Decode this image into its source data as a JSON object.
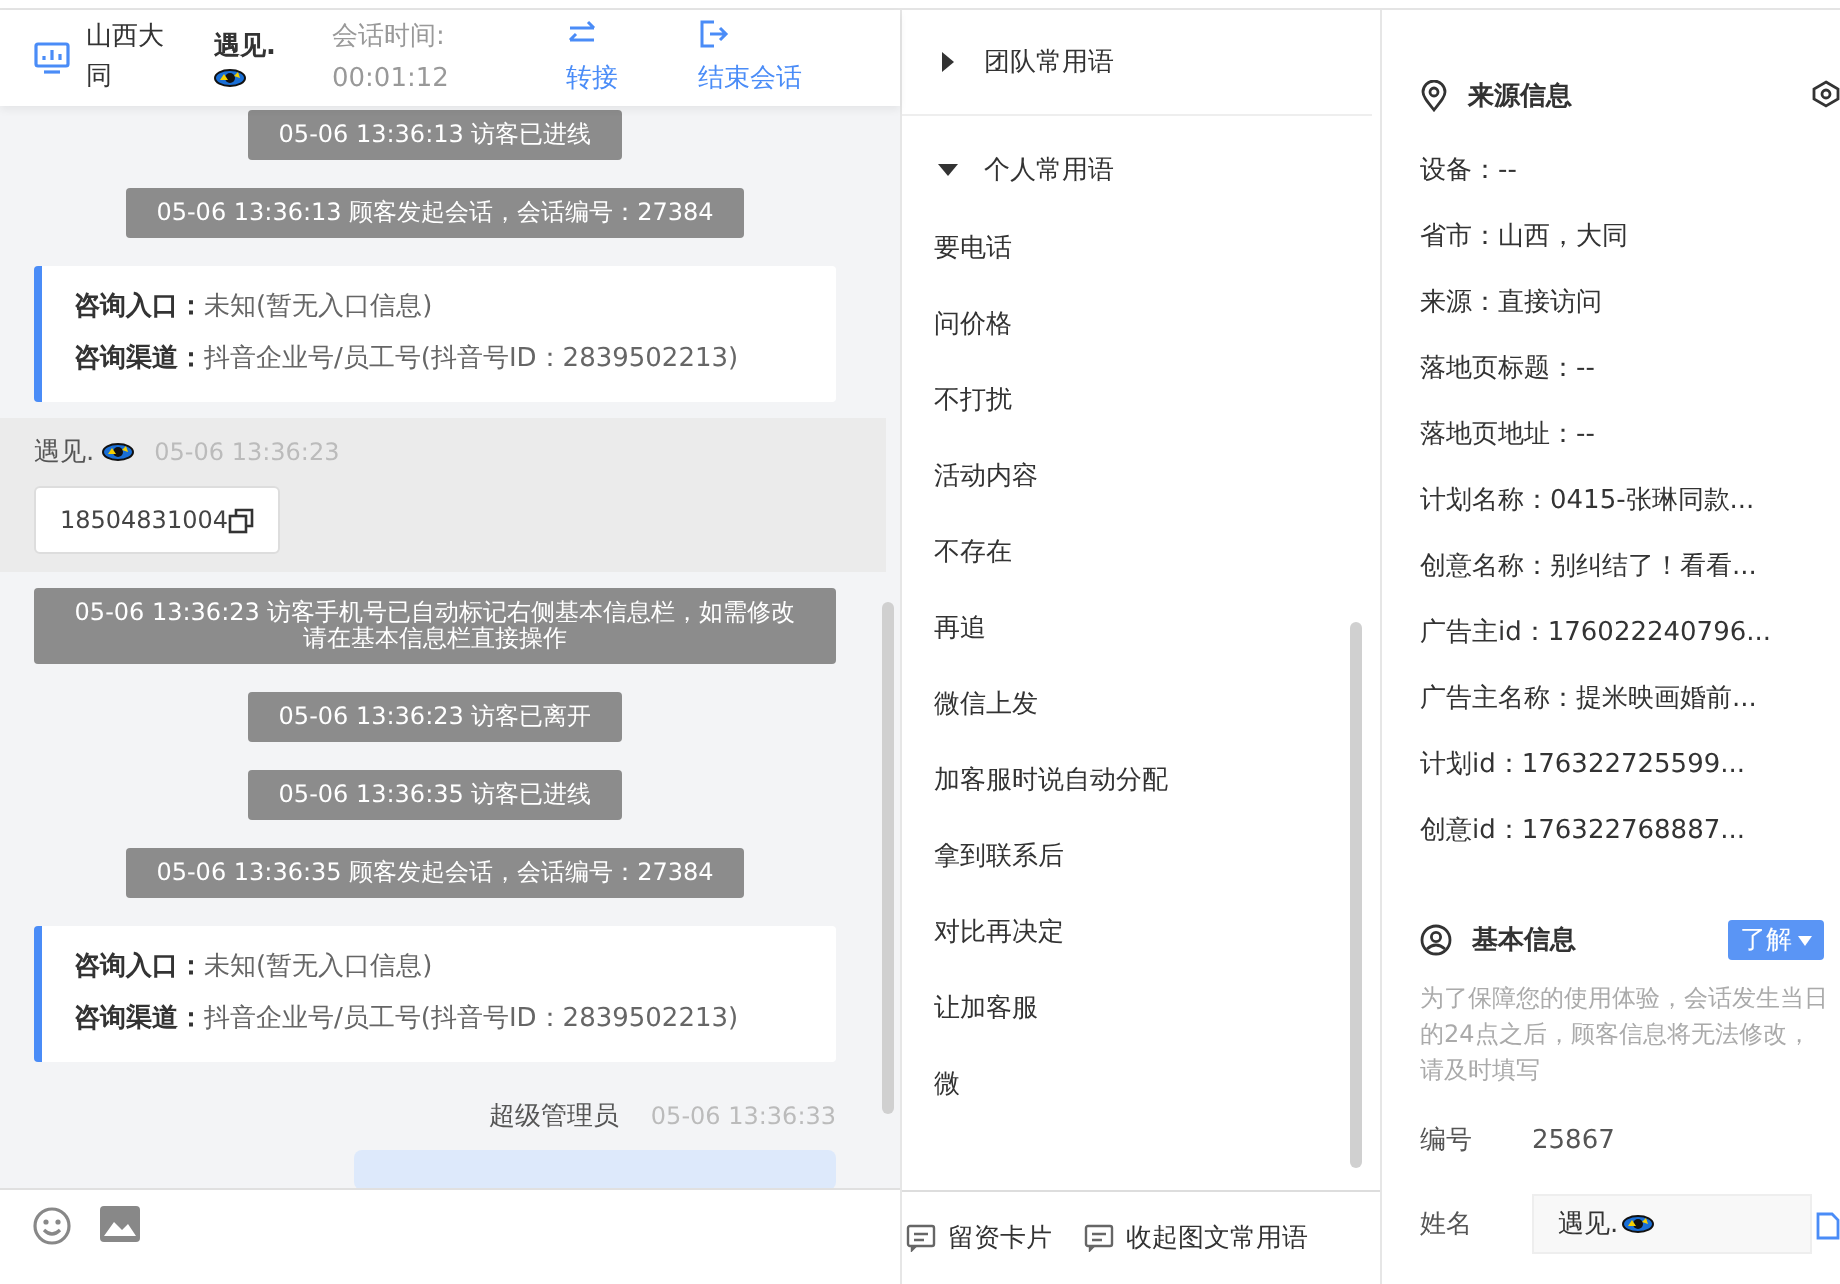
{
  "header": {
    "location": "山西大同",
    "visitor_name": "遇见.",
    "session_label": "会话时间:",
    "session_time": "00:01:12",
    "actions": [
      {
        "label": "转接",
        "kind": "transfer"
      },
      {
        "label": "结束会话",
        "kind": "end"
      }
    ]
  },
  "messages": [
    {
      "kind": "system",
      "text": "05-06 13:36:13 访客已进线"
    },
    {
      "kind": "system",
      "text": "05-06 13:36:13 顾客发起会话，会话编号：27384"
    },
    {
      "kind": "info_card",
      "rows": [
        {
          "label": "咨询入口：",
          "value": "未知(暂无入口信息)"
        },
        {
          "label": "咨询渠道：",
          "value": "抖音企业号/员工号(抖音号ID：2839502213)"
        }
      ]
    },
    {
      "kind": "visitor",
      "sender": "遇见.",
      "time": "05-06 13:36:23",
      "text": "18504831004"
    },
    {
      "kind": "system",
      "text": "05-06 13:36:23 访客手机号已自动标记右侧基本信息栏，如需修改请在基本信息栏直接操作"
    },
    {
      "kind": "system",
      "text": "05-06 13:36:23 访客已离开"
    },
    {
      "kind": "system",
      "text": "05-06 13:36:35 访客已进线"
    },
    {
      "kind": "system",
      "text": "05-06 13:36:35 顾客发起会话，会话编号：27384"
    },
    {
      "kind": "info_card",
      "rows": [
        {
          "label": "咨询入口：",
          "value": "未知(暂无入口信息)"
        },
        {
          "label": "咨询渠道：",
          "value": "抖音企业号/员工号(抖音号ID：2839502213)"
        }
      ]
    },
    {
      "kind": "admin",
      "sender": "超级管理员",
      "time": "05-06 13:36:33"
    }
  ],
  "phrase_groups": [
    {
      "title": "团队常用语",
      "expanded": false
    },
    {
      "title": "个人常用语",
      "expanded": true,
      "items": [
        "要电话",
        "问价格",
        "不打扰",
        "活动内容",
        "不存在",
        "再追",
        "微信上发",
        "加客服时说自动分配",
        "拿到联系后",
        "对比再决定",
        "让加客服",
        "微"
      ]
    }
  ],
  "phrase_footer": [
    {
      "label": "留资卡片"
    },
    {
      "label": "收起图文常用语"
    }
  ],
  "source_info": {
    "title": "来源信息",
    "fields": [
      "设备：--",
      "省市：山西，大同",
      "来源：直接访问",
      "落地页标题：--",
      "落地页地址：--",
      "计划名称：0415-张琳同款...",
      "创意名称：别纠结了！看看...",
      "广告主id：176022240796...",
      "广告主名称：提米映画婚前...",
      "计划id：176322725599...",
      "创意id：176322768887..."
    ]
  },
  "basic_info": {
    "title": "基本信息",
    "dropdown": "了解",
    "notice": "为了保障您的使用体验，会话发生当日的24点之后，顾客信息将无法修改，请及时填写",
    "fields": [
      {
        "kind": "text",
        "label": "编号",
        "value": "25867"
      },
      {
        "kind": "input",
        "label": "姓名",
        "value": "遇见."
      }
    ]
  }
}
